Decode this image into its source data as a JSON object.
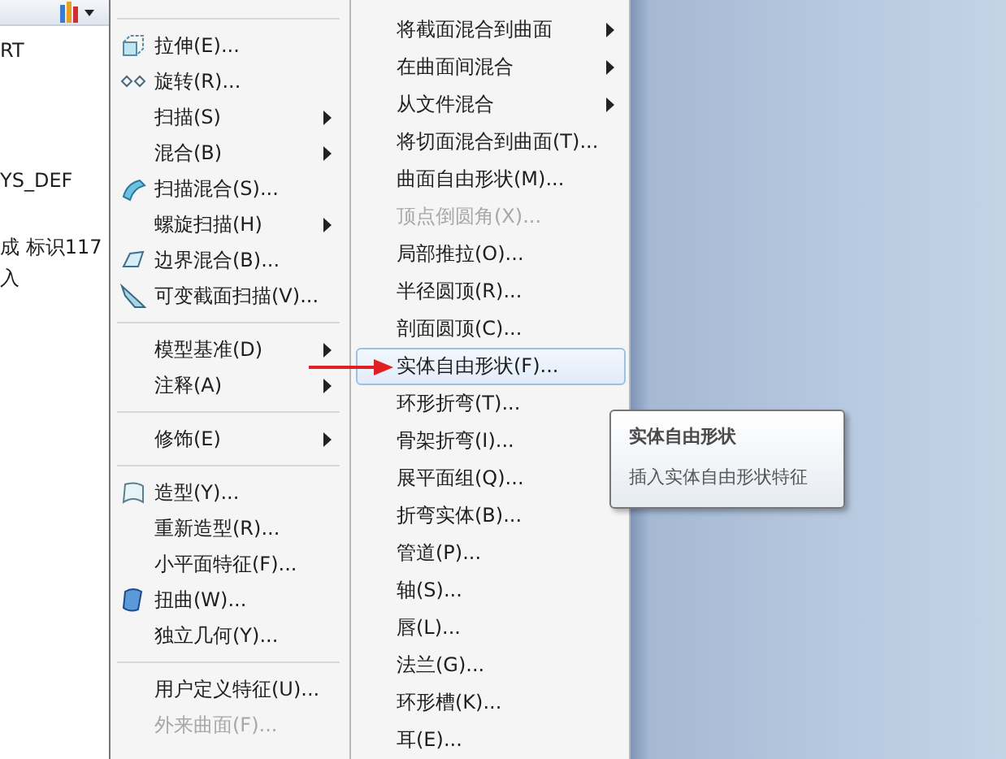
{
  "tree_panel": {
    "texts": [
      "RT",
      "YS_DEF",
      "成 标识117",
      "入"
    ]
  },
  "insert_menu": {
    "items": [
      {
        "kind": "separator"
      },
      {
        "kind": "item",
        "label": "拉伸(E)...",
        "submenu": false,
        "disabled": false,
        "selected": false
      },
      {
        "kind": "item",
        "label": "旋转(R)...",
        "submenu": false,
        "disabled": false,
        "selected": false
      },
      {
        "kind": "item",
        "label": "扫描(S)",
        "submenu": true,
        "disabled": false,
        "selected": false
      },
      {
        "kind": "item",
        "label": "混合(B)",
        "submenu": true,
        "disabled": false,
        "selected": false
      },
      {
        "kind": "item",
        "label": "扫描混合(S)...",
        "submenu": false,
        "disabled": false,
        "selected": false
      },
      {
        "kind": "item",
        "label": "螺旋扫描(H)",
        "submenu": true,
        "disabled": false,
        "selected": false
      },
      {
        "kind": "item",
        "label": "边界混合(B)...",
        "submenu": false,
        "disabled": false,
        "selected": false
      },
      {
        "kind": "item",
        "label": "可变截面扫描(V)...",
        "submenu": false,
        "disabled": false,
        "selected": false
      },
      {
        "kind": "separator"
      },
      {
        "kind": "item",
        "label": "模型基准(D)",
        "submenu": true,
        "disabled": false,
        "selected": false
      },
      {
        "kind": "item",
        "label": "注释(A)",
        "submenu": true,
        "disabled": false,
        "selected": false
      },
      {
        "kind": "separator"
      },
      {
        "kind": "item",
        "label": "修饰(E)",
        "submenu": true,
        "disabled": false,
        "selected": false
      },
      {
        "kind": "separator"
      },
      {
        "kind": "item",
        "label": "造型(Y)...",
        "submenu": false,
        "disabled": false,
        "selected": false
      },
      {
        "kind": "item",
        "label": "重新造型(R)...",
        "submenu": false,
        "disabled": false,
        "selected": false
      },
      {
        "kind": "item",
        "label": "小平面特征(F)...",
        "submenu": false,
        "disabled": false,
        "selected": false
      },
      {
        "kind": "item",
        "label": "扭曲(W)...",
        "submenu": false,
        "disabled": false,
        "selected": false
      },
      {
        "kind": "item",
        "label": "独立几何(Y)...",
        "submenu": false,
        "disabled": false,
        "selected": false
      },
      {
        "kind": "separator"
      },
      {
        "kind": "item",
        "label": "用户定义特征(U)...",
        "submenu": false,
        "disabled": false,
        "selected": false
      },
      {
        "kind": "item",
        "label": "外来曲面(F)...",
        "submenu": false,
        "disabled": true,
        "selected": false
      }
    ]
  },
  "advanced_menu": {
    "items": [
      {
        "label": "将截面混合到曲面",
        "submenu": true,
        "disabled": false,
        "selected": false
      },
      {
        "label": "在曲面间混合",
        "submenu": true,
        "disabled": false,
        "selected": false
      },
      {
        "label": "从文件混合",
        "submenu": true,
        "disabled": false,
        "selected": false
      },
      {
        "label": "将切面混合到曲面(T)...",
        "submenu": false,
        "disabled": false,
        "selected": false
      },
      {
        "label": "曲面自由形状(M)...",
        "submenu": false,
        "disabled": false,
        "selected": false
      },
      {
        "label": "顶点倒圆角(X)...",
        "submenu": false,
        "disabled": true,
        "selected": false
      },
      {
        "label": "局部推拉(O)...",
        "submenu": false,
        "disabled": false,
        "selected": false
      },
      {
        "label": "半径圆顶(R)...",
        "submenu": false,
        "disabled": false,
        "selected": false
      },
      {
        "label": "剖面圆顶(C)...",
        "submenu": false,
        "disabled": false,
        "selected": false
      },
      {
        "label": "实体自由形状(F)...",
        "submenu": false,
        "disabled": false,
        "selected": true
      },
      {
        "label": "环形折弯(T)...",
        "submenu": false,
        "disabled": false,
        "selected": false
      },
      {
        "label": "骨架折弯(I)...",
        "submenu": false,
        "disabled": false,
        "selected": false
      },
      {
        "label": "展平面组(Q)...",
        "submenu": false,
        "disabled": false,
        "selected": false
      },
      {
        "label": "折弯实体(B)...",
        "submenu": false,
        "disabled": false,
        "selected": false
      },
      {
        "label": "管道(P)...",
        "submenu": false,
        "disabled": false,
        "selected": false
      },
      {
        "label": "轴(S)...",
        "submenu": false,
        "disabled": false,
        "selected": false
      },
      {
        "label": "唇(L)...",
        "submenu": false,
        "disabled": false,
        "selected": false
      },
      {
        "label": "法兰(G)...",
        "submenu": false,
        "disabled": false,
        "selected": false
      },
      {
        "label": "环形槽(K)...",
        "submenu": false,
        "disabled": false,
        "selected": false
      },
      {
        "label": "耳(E)...",
        "submenu": false,
        "disabled": false,
        "selected": false
      }
    ]
  },
  "tooltip": {
    "title": "实体自由形状",
    "description": "插入实体自由形状特征"
  }
}
